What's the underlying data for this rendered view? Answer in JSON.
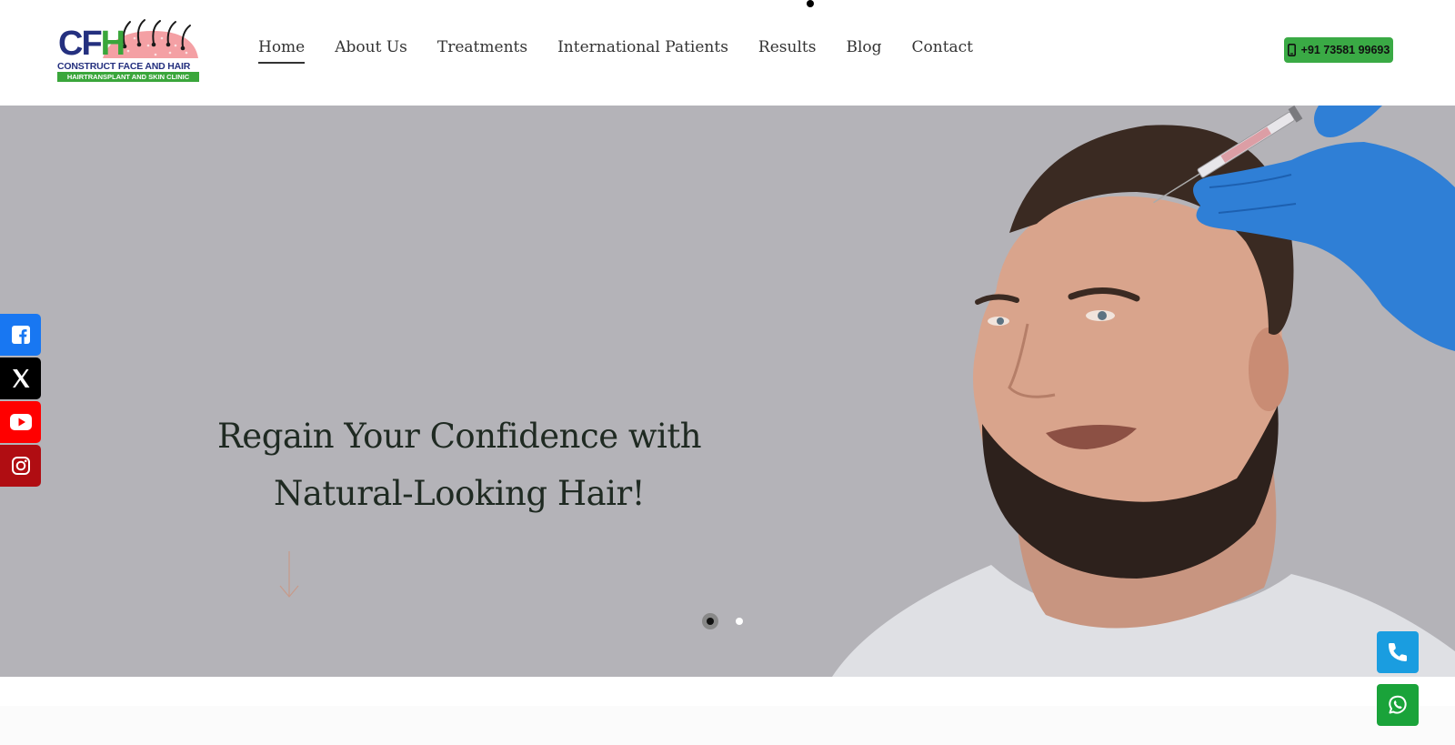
{
  "logo": {
    "letters_left": "CF",
    "letters_right": "H",
    "tagline": "CONSTRUCT FACE AND HAIR",
    "subtitle": "HAIRTRANSPLANT AND SKIN CLINIC"
  },
  "nav": {
    "items": [
      {
        "label": "Home",
        "active": true
      },
      {
        "label": "About Us"
      },
      {
        "label": "Treatments"
      },
      {
        "label": "International Patients"
      },
      {
        "label": "Results"
      },
      {
        "label": "Blog"
      },
      {
        "label": "Contact"
      }
    ]
  },
  "header_phone": {
    "label": "+91 73581 99693",
    "icon": "mobile-phone-icon",
    "color": "#3aaa45"
  },
  "hero": {
    "headline_line1": "Regain Your Confidence with",
    "headline_line2": "Natural-Looking Hair!",
    "background_color": "#b4b3b8",
    "slides": {
      "count": 2,
      "active": 1
    }
  },
  "social": [
    {
      "name": "facebook",
      "icon": "facebook-icon",
      "color": "#1877f2"
    },
    {
      "name": "x",
      "icon": "x-icon",
      "color": "#000000"
    },
    {
      "name": "youtube",
      "icon": "youtube-icon",
      "color": "#ff0000"
    },
    {
      "name": "instagram",
      "icon": "instagram-icon",
      "color": "#b00d12"
    }
  ],
  "floating": [
    {
      "name": "call",
      "icon": "phone-icon",
      "color": "#1a9de0"
    },
    {
      "name": "whatsapp",
      "icon": "whatsapp-icon",
      "color": "#1aa33a"
    }
  ]
}
